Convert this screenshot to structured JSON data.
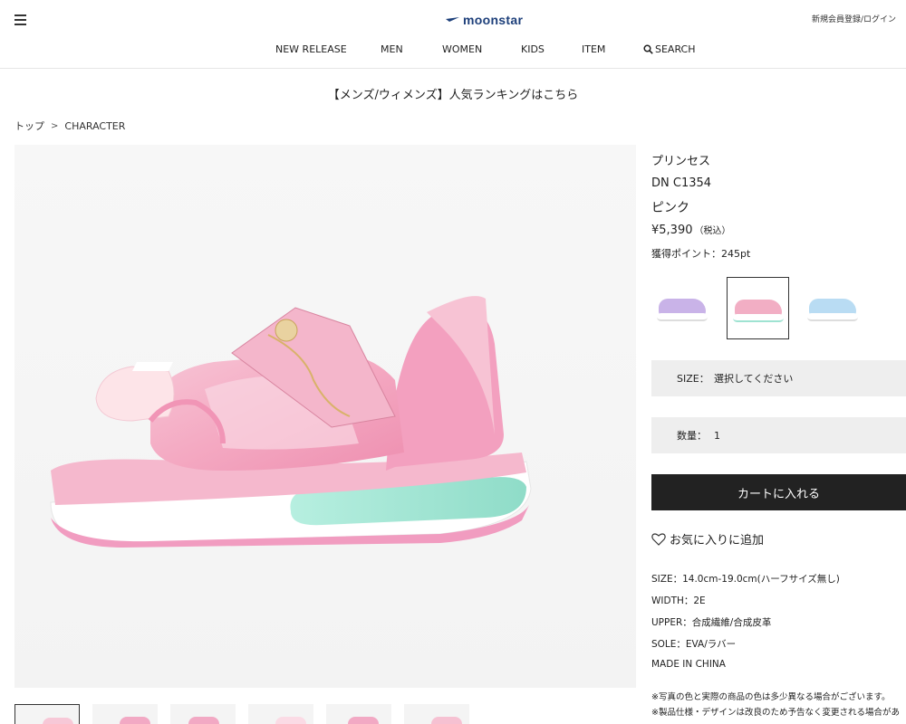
{
  "header": {
    "brand": "moonstar",
    "login": "新規会員登録/ログイン",
    "nav": [
      {
        "label": "NEW RELEASE"
      },
      {
        "label": "MEN"
      },
      {
        "label": "WOMEN"
      },
      {
        "label": "KIDS"
      },
      {
        "label": "ITEM"
      },
      {
        "label": "SEARCH"
      }
    ]
  },
  "banner": "【メンズ/ウィメンズ】人気ランキングはこちら",
  "breadcrumb": {
    "items": [
      "トップ",
      "CHARACTER"
    ],
    "separator": ">"
  },
  "product": {
    "series": "プリンセス",
    "code": "DN C1354",
    "color": "ピンク",
    "price": "¥5,390",
    "tax_note": "（税込）",
    "points": "獲得ポイント：245pt",
    "swatches": [
      {
        "color_name": "purple",
        "hex": "#c9b3e8"
      },
      {
        "color_name": "pink",
        "hex": "#f2aec4"
      },
      {
        "color_name": "light-blue",
        "hex": "#b9dcf3"
      }
    ],
    "size_label": "SIZE：",
    "size_value": "選択してください",
    "qty_label": "数量：",
    "qty_value": "1",
    "cart_button": "カートに入れる",
    "favorite": "お気に入りに追加",
    "specs": [
      "SIZE：14.0cm-19.0cm(ハーフサイズ無し)",
      "WIDTH：2E",
      "UPPER：合成繊維/合成皮革",
      "SOLE：EVA/ラバー",
      "MADE IN CHINA"
    ],
    "notes": [
      "※写真の色と実際の商品の色は多少異なる場合がございます。",
      "※製品仕様・デザインは改良のため予告なく変更される場合があ"
    ]
  },
  "colors": {
    "brand_blue": "#1d3f7a",
    "cart_bg": "#222222",
    "select_bg": "#eeeeee",
    "shoe_pink": "#f2aec4",
    "sole_mint": "#9fe3d2"
  }
}
